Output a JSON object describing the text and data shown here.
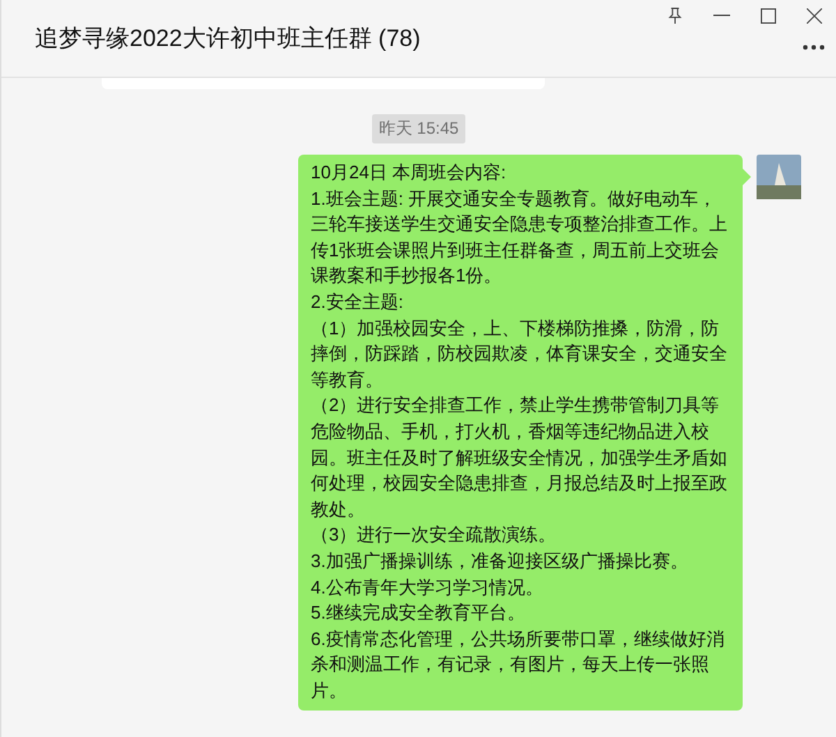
{
  "window": {
    "title": "追梦寻缘2022大许初中班主任群 (78)"
  },
  "messages": [
    {
      "kind": "cut"
    },
    {
      "kind": "time",
      "text": "昨天 15:45"
    },
    {
      "kind": "outgoing",
      "paragraphs": [
        "10月24日  本周班会内容:",
        "1.班会主题: 开展交通安全专题教育。做好电动车，三轮车接送学生交通安全隐患专项整治排查工作。上传1张班会课照片到班主任群备查，周五前上交班会课教案和手抄报各1份。",
        "2.安全主题:",
        "（1）加强校园安全，上、下楼梯防推搡，防滑，防摔倒，防踩踏，防校园欺凌，体育课安全，交通安全等教育。",
        "（2）进行安全排查工作，禁止学生携带管制刀具等危险物品、手机，打火机，香烟等违纪物品进入校园。班主任及时了解班级安全情况，加强学生矛盾如何处理，校园安全隐患排查，月报总结及时上报至政教处。",
        "（3）进行一次安全疏散演练。",
        "3.加强广播操训练，准备迎接区级广播操比赛。",
        "4.公布青年大学习学习情况。",
        "5.继续完成安全教育平台。",
        "6.疫情常态化管理，公共场所要带口罩，继续做好消杀和测温工作，有记录，有图片，每天上传一张照片。"
      ]
    }
  ]
}
